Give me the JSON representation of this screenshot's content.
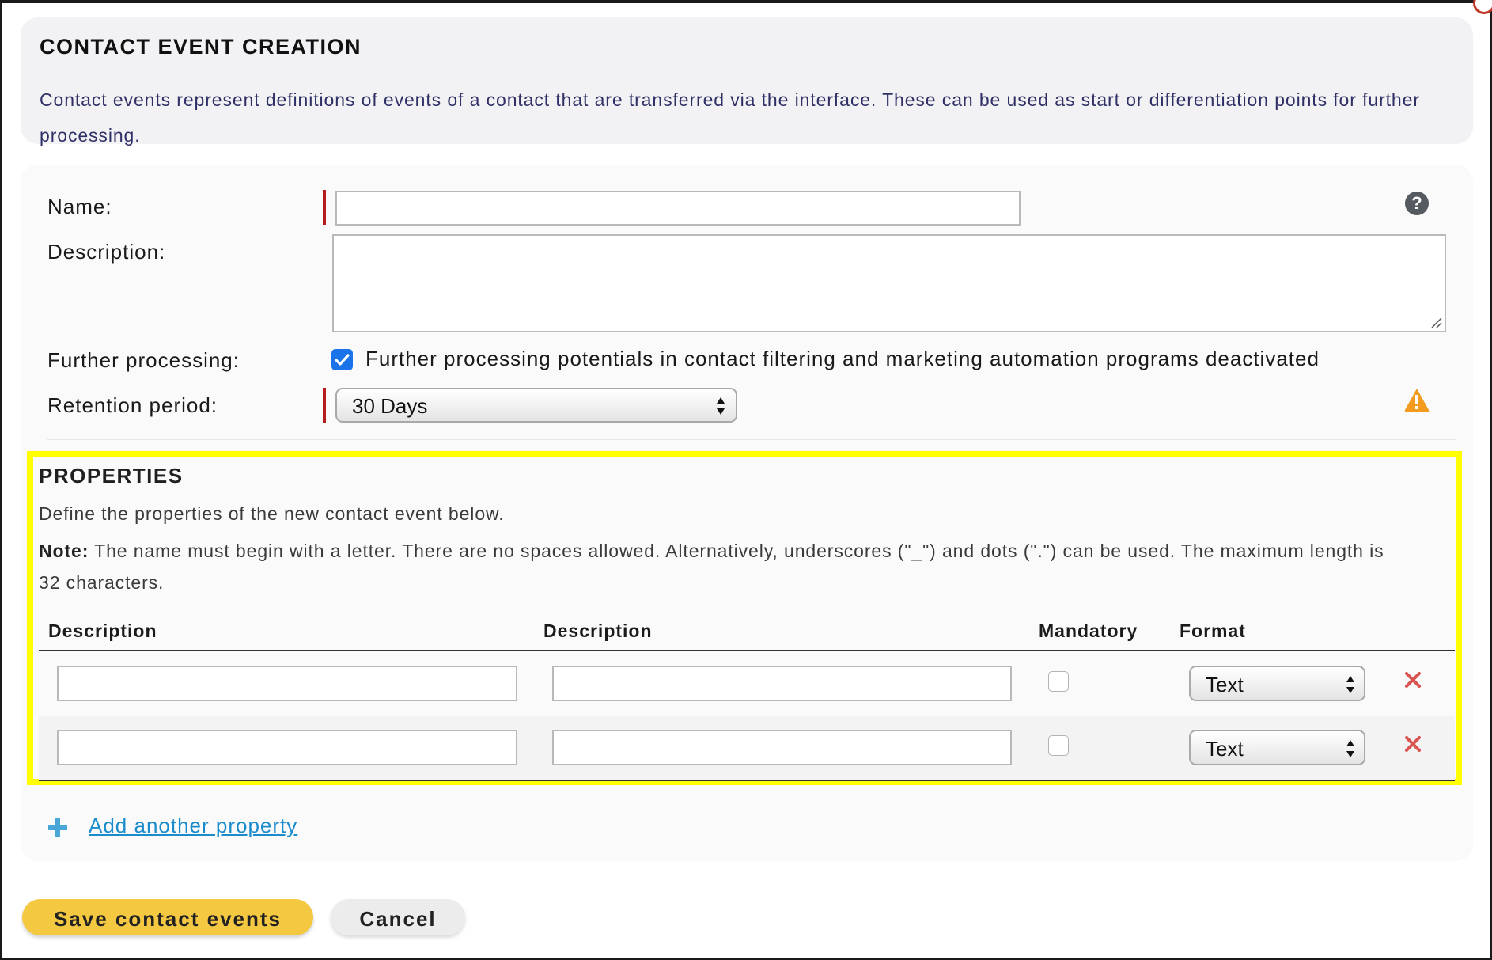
{
  "header": {
    "title": "CONTACT EVENT CREATION",
    "description": "Contact events represent definitions of events of a contact that are transferred via the interface. These can be used as start or differentiation points for further processing."
  },
  "form": {
    "name_label": "Name:",
    "name_value": "",
    "description_label": "Description:",
    "description_value": "",
    "further_processing_label": "Further processing:",
    "further_processing_checked": true,
    "further_processing_text": "Further processing potentials in contact filtering and marketing automation programs deactivated",
    "retention_label": "Retention period:",
    "retention_value": "30 Days",
    "help_icon": "question-icon",
    "warning_icon": "warning-icon"
  },
  "properties": {
    "title": "PROPERTIES",
    "description": "Define the properties of the new contact event below.",
    "note_label": "Note:",
    "note_text": " The name must begin with a letter. There are no spaces allowed. Alternatively, underscores (\"_\") and dots (\".\") can be used. The maximum length is 32 characters.",
    "columns": [
      "Description",
      "Description",
      "Mandatory",
      "Format"
    ],
    "rows": [
      {
        "name": "",
        "description": "",
        "mandatory": false,
        "format": "Text"
      },
      {
        "name": "",
        "description": "",
        "mandatory": false,
        "format": "Text"
      }
    ],
    "add_link": "Add another property"
  },
  "buttons": {
    "save": "Save contact events",
    "cancel": "Cancel"
  },
  "colors": {
    "highlight": "#ffff00",
    "save_button": "#f5c842",
    "required_marker": "#b71c1c",
    "link": "#1a8ccc",
    "delete": "#d9534f"
  }
}
